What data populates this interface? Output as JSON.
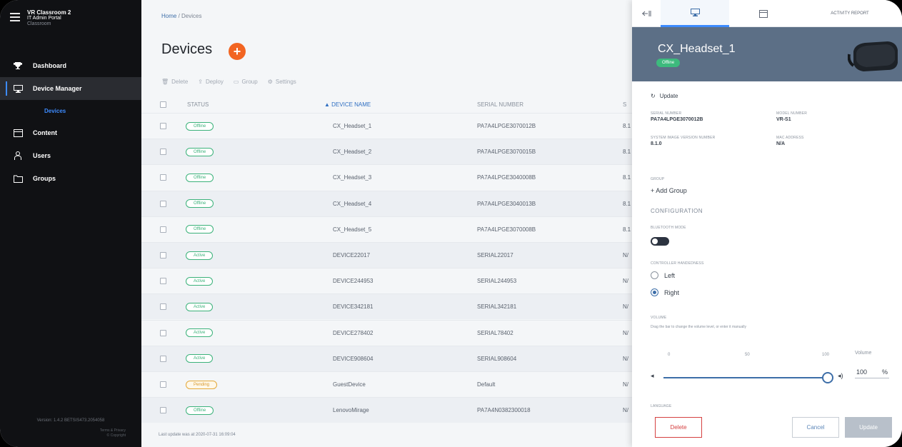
{
  "app": {
    "title_line1": "VR Classroom 2",
    "title_line2": "IT Admin Portal",
    "title_line3": "Classroom",
    "version": "Version: 1.4.2 BETSIS473.2054058",
    "version_sub1": "Terms & Privacy",
    "version_sub2": "© Copyright"
  },
  "nav": [
    {
      "label": "Dashboard",
      "icon": "trophy-icon"
    },
    {
      "label": "Device Manager",
      "icon": "monitor-icon"
    },
    {
      "label": "Content",
      "icon": "calendar-icon"
    },
    {
      "label": "Users",
      "icon": "user-icon"
    },
    {
      "label": "Groups",
      "icon": "folder-icon"
    }
  ],
  "nav_sub": "Devices",
  "breadcrumb": {
    "home": "Home",
    "sep": " / ",
    "current": "Devices"
  },
  "page_title": "Devices",
  "toolbar": {
    "delete": "Delete",
    "deploy": "Deploy",
    "group": "Group",
    "settings": "Settings"
  },
  "table": {
    "headers": {
      "status": "STATUS",
      "device": "▲ DEVICE NAME",
      "serial": "SERIAL NUMBER",
      "more": "S"
    },
    "rows": [
      {
        "status": "Offline",
        "kind": "offline",
        "name": "CX_Headset_1",
        "serial": "PA7A4LPGE3070012B",
        "trail": "8.1"
      },
      {
        "status": "Offline",
        "kind": "offline",
        "name": "CX_Headset_2",
        "serial": "PA7A4LPGE3070015B",
        "trail": "8.1"
      },
      {
        "status": "Offline",
        "kind": "offline",
        "name": "CX_Headset_3",
        "serial": "PA7A4LPGE3040008B",
        "trail": "8.1"
      },
      {
        "status": "Offline",
        "kind": "offline",
        "name": "CX_Headset_4",
        "serial": "PA7A4LPGE3040013B",
        "trail": "8.1"
      },
      {
        "status": "Offline",
        "kind": "offline",
        "name": "CX_Headset_5",
        "serial": "PA7A4LPGE3070008B",
        "trail": "8.1"
      },
      {
        "status": "Active",
        "kind": "active",
        "name": "DEVICE22017",
        "serial": "SERIAL22017",
        "trail": "N/"
      },
      {
        "status": "Active",
        "kind": "active",
        "name": "DEVICE244953",
        "serial": "SERIAL244953",
        "trail": "N/"
      },
      {
        "status": "Active",
        "kind": "active",
        "name": "DEVICE342181",
        "serial": "SERIAL342181",
        "trail": "N/"
      },
      {
        "status": "Active",
        "kind": "active",
        "name": "DEVICE278402",
        "serial": "SERIAL78402",
        "trail": "N/"
      },
      {
        "status": "Active",
        "kind": "active",
        "name": "DEVICE908604",
        "serial": "SERIAL908604",
        "trail": "N/"
      },
      {
        "status": "Pending",
        "kind": "pending",
        "name": "GuestDevice",
        "serial": "Default",
        "trail": "N/"
      },
      {
        "status": "Offline",
        "kind": "offline",
        "name": "LenovoMirage",
        "serial": "PA7A4N0382300018",
        "trail": "N/"
      }
    ]
  },
  "footer_note": "Last update was at 2020-07-31 16:09:04",
  "panel": {
    "tab_activity": "ACTIVITY REPORT",
    "device_name": "CX_Headset_1",
    "status": "Offline",
    "update_link": "Update",
    "serial_label": "SERIAL NUMBER",
    "serial_value": "PA7A4LPGE3070012B",
    "model_label": "MODEL NUMBER",
    "model_value": "VR-S1",
    "firmware_label": "SYSTEM IMAGE VERSION NUMBER",
    "firmware_value": "8.1.0",
    "mac_label": "MAC ADDRESS",
    "mac_value": "N/A",
    "group_label": "GROUP",
    "add_group": "+  Add Group",
    "config_title": "CONFIGURATION",
    "bt_label": "BLUETOOTH MODE",
    "hand_label": "CONTROLLER HANDEDNESS",
    "left": "Left",
    "right": "Right",
    "volume_label": "VOLUME",
    "volume_hint": "Drag the bar to change the volume level, or enter it manually",
    "tick0": "0",
    "tick50": "50",
    "tick100": "100",
    "volume_field_label": "Volume",
    "volume_value": "100",
    "volume_unit": "%",
    "volume_level": 100,
    "more_label": "LANGUAGE",
    "delete": "Delete",
    "cancel": "Cancel",
    "update": "Update"
  },
  "colors": {
    "accent": "#3d8bff",
    "add": "#f26522",
    "active": "#3bb27a",
    "pending": "#e4a93b",
    "danger": "#d54141",
    "panel_head": "#5c6f86"
  }
}
